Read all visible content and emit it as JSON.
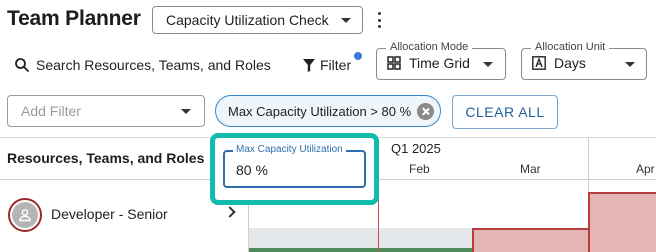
{
  "app": {
    "title": "Team Planner"
  },
  "header": {
    "view_select": "Capacity Utilization Check",
    "search_label": "Search Resources, Teams, and Roles",
    "filter_label": "Filter",
    "allocation_mode": {
      "legend": "Allocation Mode",
      "value": "Time Grid",
      "icon": "grid-icon"
    },
    "allocation_unit": {
      "legend": "Allocation Unit",
      "value": "Days",
      "icon": "letter-a-icon"
    }
  },
  "filters": {
    "add_filter_placeholder": "Add Filter",
    "active_chip": "Max Capacity Utilization > 80 %",
    "clear_all": "CLEAR ALL"
  },
  "popover": {
    "legend": "Max Capacity Utilization",
    "value": "80 %"
  },
  "grid": {
    "column_header": "Resources, Teams, and Roles",
    "quarter": "Q1 2025",
    "months": [
      "Feb",
      "Mar",
      "Apr"
    ],
    "rows": [
      {
        "name": "Developer - Senior",
        "icon": "person-icon"
      }
    ]
  },
  "colors": {
    "highlight": "#12bcad",
    "accent": "#2f6fb0",
    "over_allocation": "#e3b6b5",
    "over_allocation_border": "#b73c3c",
    "allocation_ok": "#4f8a5b"
  }
}
